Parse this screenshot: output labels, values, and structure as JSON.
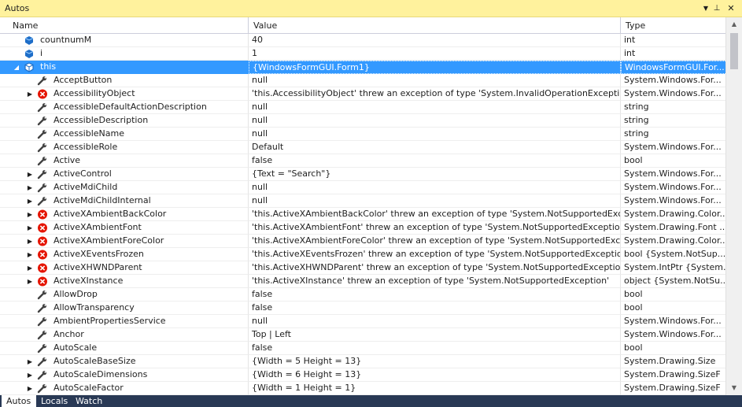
{
  "window": {
    "title": "Autos",
    "dropdown_glyph": "▼",
    "pin_glyph": "⊥",
    "close_glyph": "✕"
  },
  "columns": {
    "name": "Name",
    "value": "Value",
    "type": "Type"
  },
  "rows": [
    {
      "name": "countnumM",
      "value": "40",
      "type": "int",
      "icon": "local-variable-icon",
      "level": 0,
      "expander": ""
    },
    {
      "name": "i",
      "value": "1",
      "type": "int",
      "icon": "local-variable-icon",
      "level": 0,
      "expander": ""
    },
    {
      "name": "this",
      "value": "{WindowsFormGUI.Form1}",
      "type": "WindowsFormGUI.For...",
      "icon": "object-icon",
      "level": 0,
      "expander": "expanded",
      "selected": true
    },
    {
      "name": "AcceptButton",
      "value": "null",
      "type": "System.Windows.For...",
      "icon": "property-wrench-icon",
      "level": 1,
      "expander": ""
    },
    {
      "name": "AccessibilityObject",
      "value": "'this.AccessibilityObject' threw an exception of type 'System.InvalidOperationException'",
      "type": "System.Windows.For...",
      "icon": "exception-error-icon",
      "level": 1,
      "expander": "collapsed"
    },
    {
      "name": "AccessibleDefaultActionDescription",
      "value": "null",
      "type": "string",
      "icon": "property-wrench-icon",
      "level": 1,
      "expander": ""
    },
    {
      "name": "AccessibleDescription",
      "value": "null",
      "type": "string",
      "icon": "property-wrench-icon",
      "level": 1,
      "expander": ""
    },
    {
      "name": "AccessibleName",
      "value": "null",
      "type": "string",
      "icon": "property-wrench-icon",
      "level": 1,
      "expander": ""
    },
    {
      "name": "AccessibleRole",
      "value": "Default",
      "type": "System.Windows.For...",
      "icon": "property-wrench-icon",
      "level": 1,
      "expander": ""
    },
    {
      "name": "Active",
      "value": "false",
      "type": "bool",
      "icon": "property-wrench-icon",
      "level": 1,
      "expander": ""
    },
    {
      "name": "ActiveControl",
      "value": "{Text = \"Search\"}",
      "type": "System.Windows.For...",
      "icon": "property-wrench-icon",
      "level": 1,
      "expander": "collapsed"
    },
    {
      "name": "ActiveMdiChild",
      "value": "null",
      "type": "System.Windows.For...",
      "icon": "property-wrench-icon",
      "level": 1,
      "expander": "collapsed"
    },
    {
      "name": "ActiveMdiChildInternal",
      "value": "null",
      "type": "System.Windows.For...",
      "icon": "property-wrench-icon",
      "level": 1,
      "expander": "collapsed"
    },
    {
      "name": "ActiveXAmbientBackColor",
      "value": "'this.ActiveXAmbientBackColor' threw an exception of type 'System.NotSupportedExce...",
      "type": "System.Drawing.Color...",
      "icon": "exception-error-icon",
      "level": 1,
      "expander": "collapsed"
    },
    {
      "name": "ActiveXAmbientFont",
      "value": "'this.ActiveXAmbientFont' threw an exception of type 'System.NotSupportedException'",
      "type": "System.Drawing.Font ...",
      "icon": "exception-error-icon",
      "level": 1,
      "expander": "collapsed"
    },
    {
      "name": "ActiveXAmbientForeColor",
      "value": "'this.ActiveXAmbientForeColor' threw an exception of type 'System.NotSupportedExce...",
      "type": "System.Drawing.Color...",
      "icon": "exception-error-icon",
      "level": 1,
      "expander": "collapsed"
    },
    {
      "name": "ActiveXEventsFrozen",
      "value": "'this.ActiveXEventsFrozen' threw an exception of type 'System.NotSupportedException'",
      "type": "bool {System.NotSup...",
      "icon": "exception-error-icon",
      "level": 1,
      "expander": "collapsed"
    },
    {
      "name": "ActiveXHWNDParent",
      "value": "'this.ActiveXHWNDParent' threw an exception of type 'System.NotSupportedException'",
      "type": "System.IntPtr {System....",
      "icon": "exception-error-icon",
      "level": 1,
      "expander": "collapsed"
    },
    {
      "name": "ActiveXInstance",
      "value": "'this.ActiveXInstance' threw an exception of type 'System.NotSupportedException'",
      "type": "object {System.NotSu...",
      "icon": "exception-error-icon",
      "level": 1,
      "expander": "collapsed"
    },
    {
      "name": "AllowDrop",
      "value": "false",
      "type": "bool",
      "icon": "property-wrench-icon",
      "level": 1,
      "expander": ""
    },
    {
      "name": "AllowTransparency",
      "value": "false",
      "type": "bool",
      "icon": "property-wrench-icon",
      "level": 1,
      "expander": ""
    },
    {
      "name": "AmbientPropertiesService",
      "value": "null",
      "type": "System.Windows.For...",
      "icon": "property-wrench-icon",
      "level": 1,
      "expander": ""
    },
    {
      "name": "Anchor",
      "value": "Top | Left",
      "type": "System.Windows.For...",
      "icon": "property-wrench-icon",
      "level": 1,
      "expander": ""
    },
    {
      "name": "AutoScale",
      "value": "false",
      "type": "bool",
      "icon": "property-wrench-icon",
      "level": 1,
      "expander": ""
    },
    {
      "name": "AutoScaleBaseSize",
      "value": "{Width = 5 Height = 13}",
      "type": "System.Drawing.Size",
      "icon": "property-wrench-icon",
      "level": 1,
      "expander": "collapsed"
    },
    {
      "name": "AutoScaleDimensions",
      "value": "{Width = 6 Height = 13}",
      "type": "System.Drawing.SizeF",
      "icon": "property-wrench-icon",
      "level": 1,
      "expander": "collapsed"
    },
    {
      "name": "AutoScaleFactor",
      "value": "{Width = 1 Height = 1}",
      "type": "System.Drawing.SizeF",
      "icon": "property-wrench-icon",
      "level": 1,
      "expander": "collapsed"
    }
  ],
  "tabs": [
    {
      "label": "Autos",
      "active": true
    },
    {
      "label": "Locals",
      "active": false
    },
    {
      "label": "Watch 1",
      "active": false
    }
  ],
  "colors": {
    "title_bg": "#fff29d",
    "selection": "#3399ff",
    "tab_bar": "#293955",
    "error_red": "#e51400",
    "var_blue": "#1e6ec8"
  }
}
